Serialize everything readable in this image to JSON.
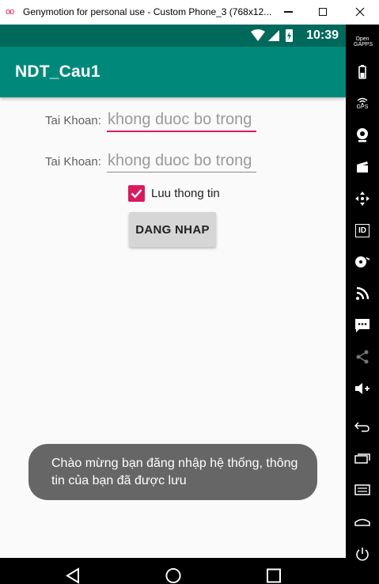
{
  "window": {
    "title": "Genymotion for personal use - Custom Phone_3 (768x12...",
    "logo": "oo"
  },
  "status_bar": {
    "time": "10:39"
  },
  "app_bar": {
    "title": "NDT_Cau1"
  },
  "form": {
    "username": {
      "label": "Tai Khoan:",
      "placeholder": "khong duoc bo trong",
      "value": ""
    },
    "password": {
      "label": "Tai Khoan:",
      "placeholder": "khong duoc bo trong",
      "value": ""
    },
    "remember": {
      "label": "Luu thong tin",
      "checked": true
    },
    "login_button": "DANG NHAP"
  },
  "toast": {
    "message": "Chào mừng bạn đăng nhập hệ thống, thông tin của bạn đã được lưu"
  },
  "sidebar": {
    "opengapps_label": "Open GAPPS",
    "gps_label": "GPS",
    "id_label": "ID"
  },
  "colors": {
    "status_bar": "#00695c",
    "app_bar": "#00897b",
    "accent": "#d81b60",
    "toast": "#666666"
  }
}
